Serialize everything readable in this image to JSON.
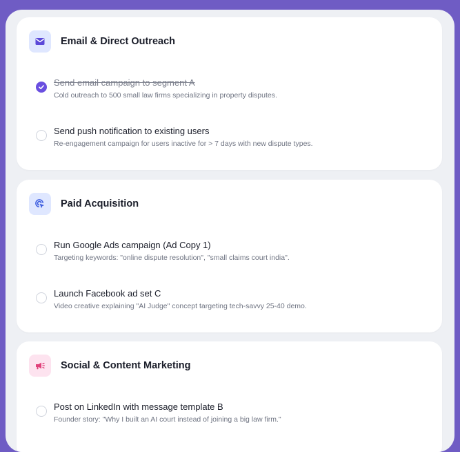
{
  "sections": [
    {
      "title": "Email & Direct Outreach",
      "icon": "envelope-icon",
      "tasks": [
        {
          "title": "Send email campaign to segment A",
          "desc": "Cold outreach to 500 small law firms specializing in property disputes.",
          "done": true
        },
        {
          "title": "Send push notification to existing users",
          "desc": "Re-engagement campaign for users inactive for > 7 days with new dispute types.",
          "done": false
        }
      ]
    },
    {
      "title": "Paid Acquisition",
      "icon": "cursor-click-icon",
      "tasks": [
        {
          "title": "Run Google Ads campaign (Ad Copy 1)",
          "desc": "Targeting keywords: \"online dispute resolution\", \"small claims court india\".",
          "done": false
        },
        {
          "title": "Launch Facebook ad set C",
          "desc": "Video creative explaining \"AI Judge\" concept targeting tech-savvy 25-40 demo.",
          "done": false
        }
      ]
    },
    {
      "title": "Social & Content Marketing",
      "icon": "megaphone-icon",
      "tasks": [
        {
          "title": "Post on LinkedIn with message template B",
          "desc": "Founder story: \"Why I built an AI court instead of joining a big law firm.\"",
          "done": false
        }
      ]
    }
  ],
  "colors": {
    "accent": "#6a4fe0",
    "background": "#6f5cc4",
    "panel": "#eef0f4",
    "social_icon": "#e0407a"
  }
}
